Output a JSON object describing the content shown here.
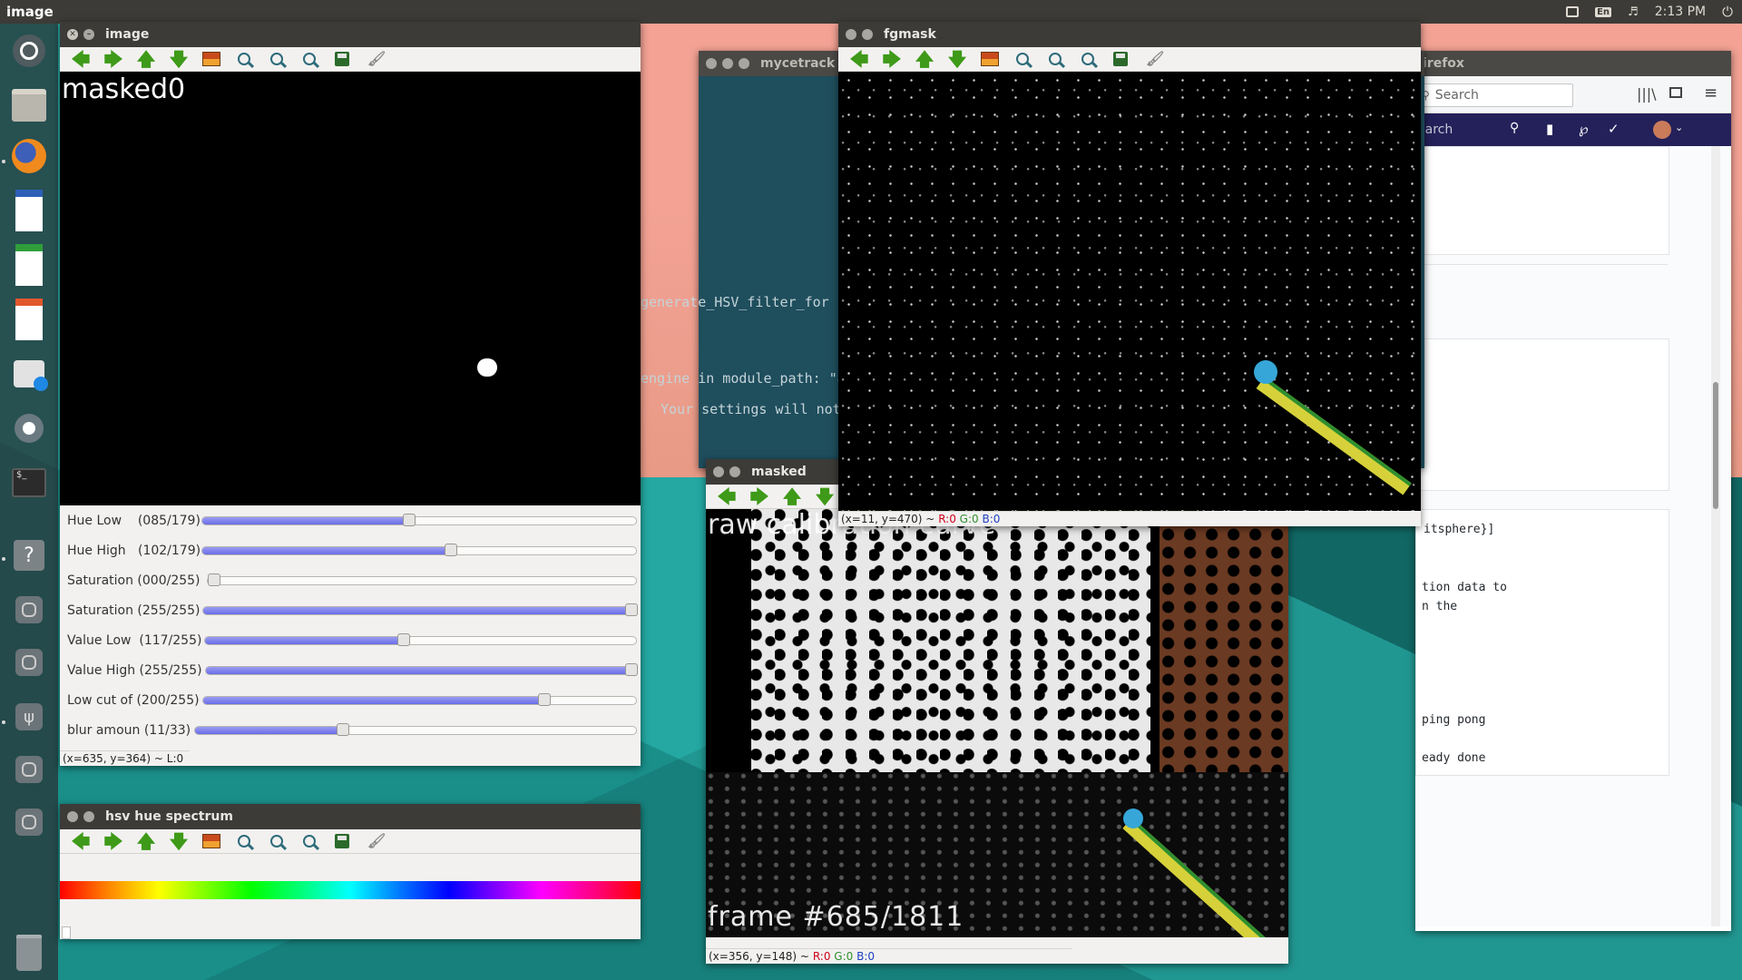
{
  "top_panel": {
    "app_name": "image",
    "clock": "2:13 PM",
    "keyboard_layout": "En"
  },
  "launcher": {
    "items": [
      "dash-icon",
      "files-icon",
      "firefox-icon",
      "writer-icon",
      "calc-icon",
      "impress-icon",
      "software-center-icon",
      "settings-icon",
      "terminal-icon",
      "help-icon",
      "disk-icon",
      "disk-icon",
      "usb-icon",
      "disk-icon",
      "disk-icon",
      "trash-icon"
    ]
  },
  "windows": {
    "image": {
      "title": "image",
      "overlay_text": "masked0",
      "status": "(x=635, y=364) ~ L:0",
      "sliders": [
        {
          "label": "Hue Low    (085/179)",
          "value": 85,
          "max": 179
        },
        {
          "label": "Hue High   (102/179)",
          "value": 102,
          "max": 179
        },
        {
          "label": "Saturation (000/255)",
          "value": 0,
          "max": 255
        },
        {
          "label": "Saturation (255/255)",
          "value": 255,
          "max": 255
        },
        {
          "label": "Value Low  (117/255)",
          "value": 117,
          "max": 255
        },
        {
          "label": "Value High (255/255)",
          "value": 255,
          "max": 255
        },
        {
          "label": "Low cut of (200/255)",
          "value": 200,
          "max": 255
        },
        {
          "label": "blur amoun (11/33)",
          "value": 11,
          "max": 33
        }
      ]
    },
    "hsv": {
      "title": "hsv hue spectrum"
    },
    "mycetrack": {
      "title": "mycetrack",
      "lines": [
        "generate_HSV_filter_for",
        "engine in module_path: \"a",
        "Your settings will not"
      ]
    },
    "fgmask": {
      "title": "fgmask",
      "status_coords": "(x=11, y=470) ~",
      "r": "R:0",
      "g": "G:0",
      "b": "B:0"
    },
    "masked": {
      "title": "masked",
      "top_text": "raw calibration curve",
      "bottom_text": "frame #685/1811",
      "status_coords": "(x=356, y=148) ~",
      "r": "R:0",
      "g": "G:0",
      "b": "B:0"
    },
    "firefox": {
      "title": "irefox",
      "search_placeholder": "Search",
      "search2_placeholder": "earch",
      "doc_lines": [
        "itsphere}]",
        "tion data to",
        "n the",
        "ping pong",
        "eady done"
      ]
    }
  }
}
